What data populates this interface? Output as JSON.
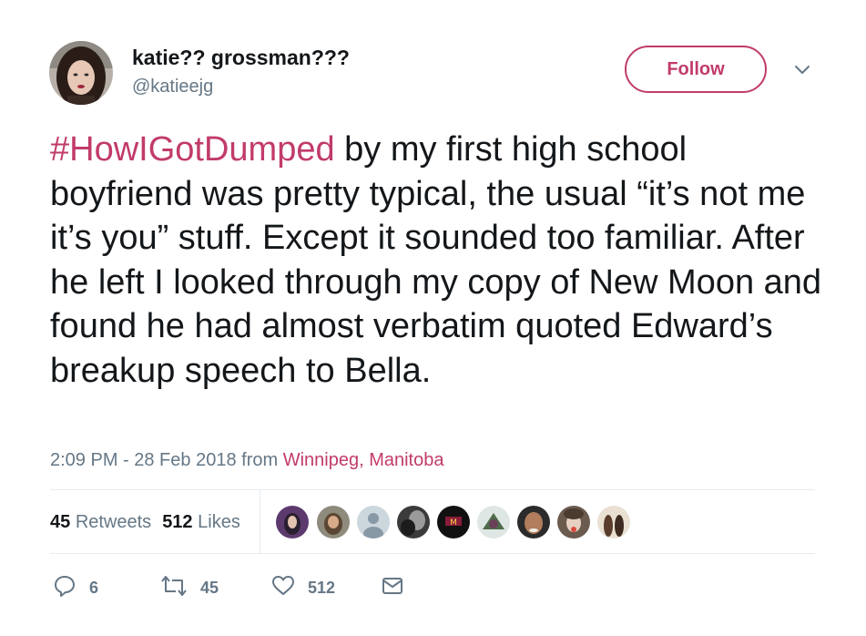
{
  "user": {
    "display_name": "katie?? grossman???",
    "handle": "@katieejg"
  },
  "header": {
    "follow_label": "Follow",
    "caret_icon": "chevron-down-icon"
  },
  "tweet": {
    "hashtag": "#HowIGotDumped",
    "text": " by my first high school boyfriend was pretty typical, the usual “it’s not me it’s you” stuff. Except it sounded too familiar. After he left I looked through my copy of New Moon and found he had almost verbatim quoted Edward’s breakup speech to Bella."
  },
  "meta": {
    "timestamp": "2:09 PM - 28 Feb 2018",
    "from_label": "from",
    "location": "Winnipeg, Manitoba"
  },
  "stats": {
    "retweets_count": "45",
    "retweets_label": "Retweets",
    "likes_count": "512",
    "likes_label": "Likes"
  },
  "actions": {
    "reply_count": "6",
    "retweet_count": "45",
    "like_count": "512"
  },
  "colors": {
    "accent": "#c13b6b",
    "secondary_text": "#657786",
    "primary_text": "#14171a",
    "divider": "#e6ecf0"
  }
}
